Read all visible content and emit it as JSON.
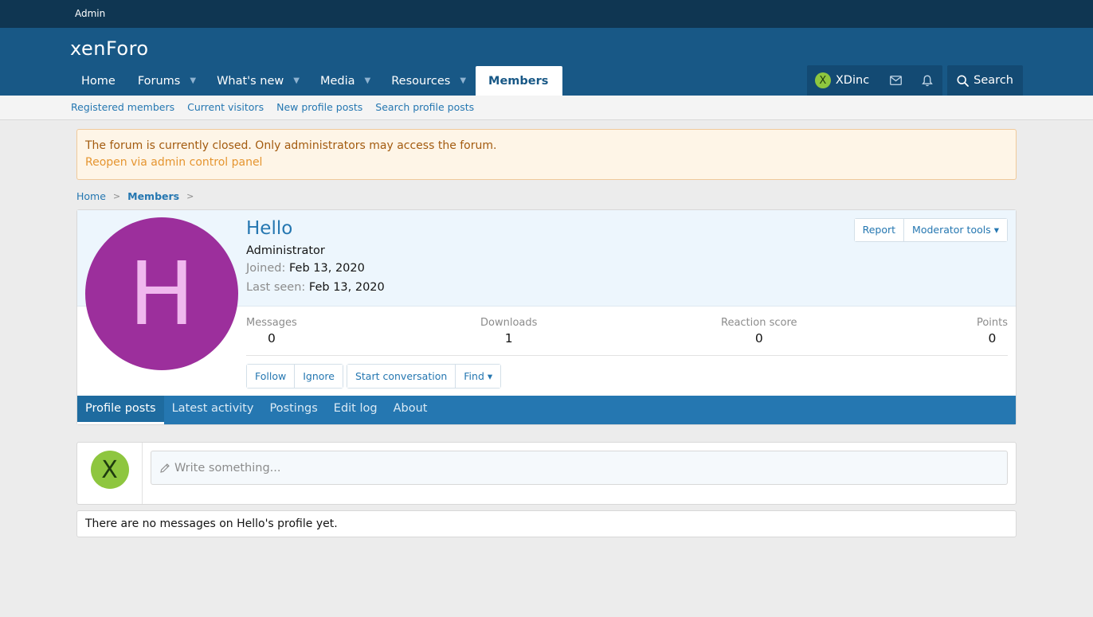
{
  "topbar": {
    "admin_label": "Admin"
  },
  "header": {
    "logo": "xenForo",
    "nav": [
      {
        "label": "Home",
        "has_menu": false,
        "active": false
      },
      {
        "label": "Forums",
        "has_menu": true,
        "active": false
      },
      {
        "label": "What's new",
        "has_menu": true,
        "active": false
      },
      {
        "label": "Media",
        "has_menu": true,
        "active": false
      },
      {
        "label": "Resources",
        "has_menu": true,
        "active": false
      },
      {
        "label": "Members",
        "has_menu": false,
        "active": true
      }
    ],
    "user": {
      "avatar_letter": "X",
      "name": "XDinc"
    },
    "search_label": "Search"
  },
  "subnav": [
    "Registered members",
    "Current visitors",
    "New profile posts",
    "Search profile posts"
  ],
  "notice": {
    "message": "The forum is currently closed. Only administrators may access the forum.",
    "link": "Reopen via admin control panel"
  },
  "breadcrumb": [
    "Home",
    "Members"
  ],
  "profile": {
    "avatar_letter": "H",
    "username": "Hello",
    "user_title": "Administrator",
    "joined_label": "Joined:",
    "joined_value": "Feb 13, 2020",
    "last_seen_label": "Last seen:",
    "last_seen_value": "Feb 13, 2020",
    "report_label": "Report",
    "moderator_tools_label": "Moderator tools",
    "stats": [
      {
        "label": "Messages",
        "value": "0"
      },
      {
        "label": "Downloads",
        "value": "1"
      },
      {
        "label": "Reaction score",
        "value": "0"
      },
      {
        "label": "Points",
        "value": "0"
      }
    ],
    "actions": {
      "follow": "Follow",
      "ignore": "Ignore",
      "start_conversation": "Start conversation",
      "find": "Find"
    },
    "tabs": [
      "Profile posts",
      "Latest activity",
      "Postings",
      "Edit log",
      "About"
    ]
  },
  "composer": {
    "avatar_letter": "X",
    "placeholder": "Write something..."
  },
  "empty_message": "There are no messages on Hello's profile yet.",
  "colors": {
    "header_bg": "#185886",
    "topbar_bg": "#0f3652",
    "accent": "#2577b1",
    "profile_avatar_bg": "#9c2f9c",
    "user_avatar_bg": "#8ec63f",
    "notice_bg": "#fef5e7"
  }
}
